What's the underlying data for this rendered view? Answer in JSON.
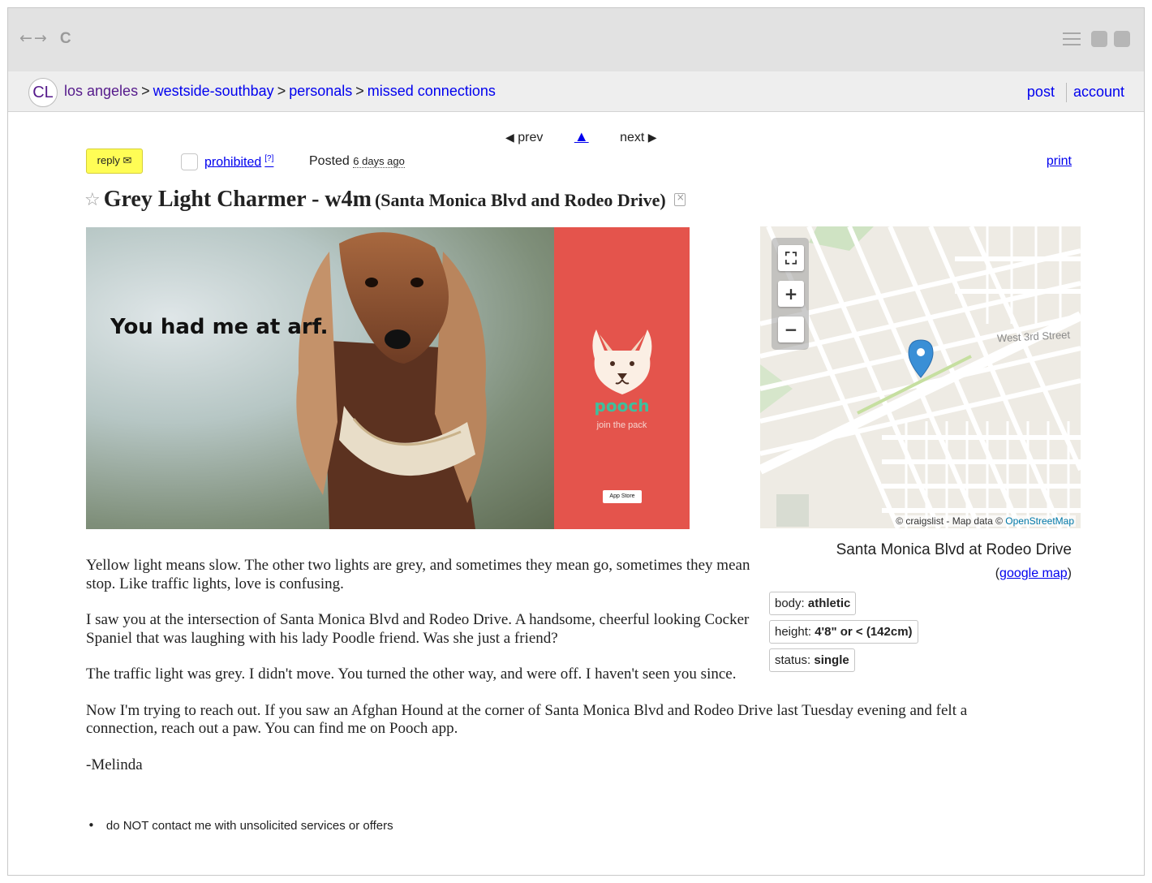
{
  "browser": {
    "back_glyph": "←",
    "forward_glyph": "→",
    "reload_glyph": "C"
  },
  "header": {
    "logo": "CL",
    "breadcrumbs": [
      {
        "label": "los angeles"
      },
      {
        "label": "westside-southbay"
      },
      {
        "label": "personals"
      },
      {
        "label": "missed connections"
      }
    ],
    "separator": ">",
    "post_label": "post",
    "account_label": "account"
  },
  "nav": {
    "prev_label": "prev",
    "next_label": "next",
    "up_glyph": "▲",
    "prev_glyph": "◀",
    "next_glyph": "▶"
  },
  "actions": {
    "reply_label": "reply ✉",
    "prohibited_label": "prohibited",
    "prohibited_help": "[?]",
    "posted_label": "Posted",
    "posted_ago": "6 days ago",
    "print_label": "print"
  },
  "title": {
    "star": "☆",
    "main": "Grey Light Charmer - w4m",
    "location": "(Santa Monica Blvd and Rodeo Drive)"
  },
  "ad": {
    "tagline": "You had me at arf.",
    "brand": "pooch",
    "brand_tag": "join the pack",
    "store_badge": "App Store"
  },
  "map": {
    "fullscreen_glyph": "⛶",
    "zoom_in": "+",
    "zoom_out": "−",
    "street_label": "West 3rd Street",
    "attribution_prefix": "© craigslist - Map data ©",
    "attribution_link": "OpenStreetMap",
    "caption": "Santa Monica Blvd at Rodeo Drive",
    "google_map_label": "google map"
  },
  "attributes": [
    {
      "key": "body:",
      "value": "athletic"
    },
    {
      "key": "height:",
      "value": "4'8\" or < (142cm)"
    },
    {
      "key": "status:",
      "value": "single"
    }
  ],
  "body": {
    "paragraphs": [
      "Yellow light means slow. The other two lights are grey, and sometimes they mean go, sometimes they mean stop. Like traffic lights, love is confusing.",
      "I saw you at the intersection of Santa Monica Blvd and Rodeo Drive. A handsome, cheerful looking Cocker Spaniel that was laughing with his lady Poodle friend. Was she just a friend?",
      "The traffic light was grey. I didn't move. You turned the other way, and were off. I haven't seen you since.",
      "Now I'm trying to reach out. If you saw an Afghan Hound at the corner of Santa Monica Blvd and Rodeo Drive last Tuesday evening and felt a connection, reach out a paw. You can find me on Pooch app.",
      "-Melinda"
    ],
    "notices": [
      "do NOT contact me with unsolicited services or offers"
    ]
  },
  "colors": {
    "link": "#0000ee",
    "visited": "#551a8b",
    "reply_bg": "#fffd55",
    "ad_panel": "#e4544c",
    "pooch_green": "#3fbf9d",
    "map_pin": "#3a8fd6"
  }
}
